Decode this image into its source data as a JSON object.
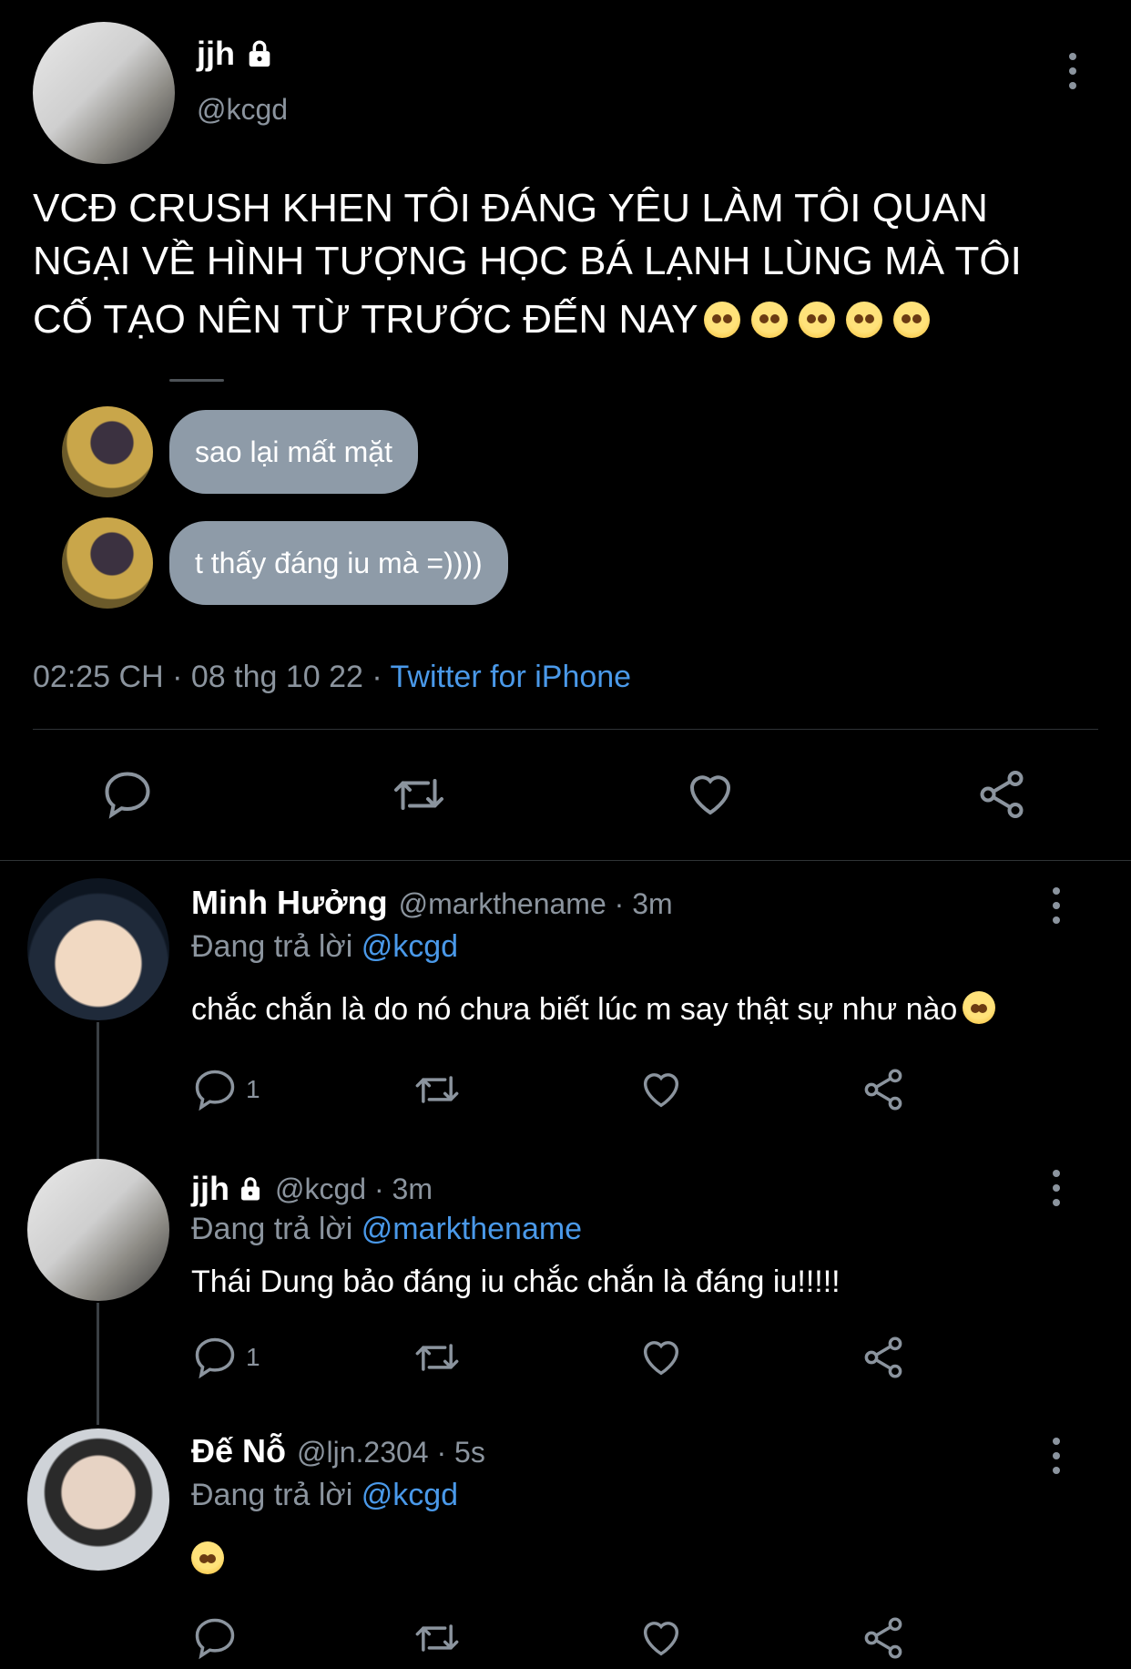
{
  "main_tweet": {
    "name": "jjh",
    "handle": "@kcgd",
    "text_line1": "VCĐ CRUSH KHEN TÔI ĐÁNG YÊU LÀM TÔI QUAN",
    "text_line2": "NGẠI VỀ HÌNH TƯỢNG HỌC BÁ LẠNH LÙNG MÀ TÔI",
    "text_line3": "CỐ TẠO NÊN TỪ TRƯỚC ĐẾN NAY",
    "chat_bubble_1": "sao lại mất mặt",
    "chat_bubble_2": "t thấy đáng iu mà =))))",
    "time_date": "02:25 CH · 08 thg 10 22 · ",
    "source": "Twitter for iPhone",
    "icons": [
      "comment-icon",
      "retweet-icon",
      "like-icon",
      "share-icon"
    ]
  },
  "replies": [
    {
      "name": "Minh Hưởng",
      "meta": "@markthename · 3m",
      "replying_prefix": "Đang trả lời ",
      "replying_to": "@kcgd",
      "text": "chắc chắn là do nó chưa biết lúc m say thật sự như nào",
      "reply_count": "1"
    },
    {
      "name": "jjh",
      "meta": "@kcgd · 3m",
      "replying_prefix": "Đang trả lời ",
      "replying_to": "@markthename",
      "text": "Thái Dung bảo đáng iu chắc chắn là đáng iu!!!!!",
      "reply_count": "1"
    },
    {
      "name": "Đế Nỗ",
      "meta": "@ljn.2304 · 5s",
      "replying_prefix": "Đang trả lời ",
      "replying_to": "@kcgd",
      "text": "",
      "reply_count": ""
    }
  ],
  "colors": {
    "background": "#000000",
    "link": "#4a99e9",
    "muted": "#8b949e",
    "bubble": "#8e9ba8"
  }
}
